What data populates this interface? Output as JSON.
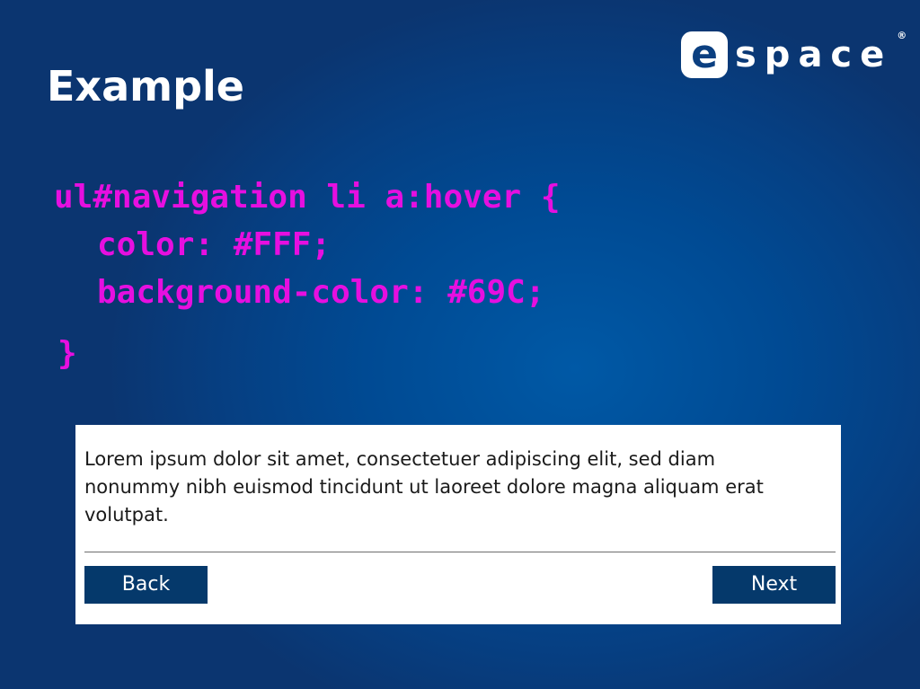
{
  "slide": {
    "title": "Example"
  },
  "logo": {
    "letter": "e",
    "rest": "space",
    "registered": "®"
  },
  "code": {
    "lines": [
      "ul#navigation li a:hover {",
      "color: #FFF;",
      "background-color: #69C;",
      "}"
    ]
  },
  "demo": {
    "paragraph": "Lorem ipsum dolor sit amet, consectetuer adipiscing elit, sed diam nonummy nibh euismod tincidunt ut laoreet dolore magna aliquam erat volutpat.",
    "back_label": "Back",
    "next_label": "Next"
  },
  "colors": {
    "background": "#004a93",
    "code_text": "#e60fe0",
    "button_background": "#05396b",
    "button_text": "#ffffff",
    "panel": "#ffffff"
  }
}
